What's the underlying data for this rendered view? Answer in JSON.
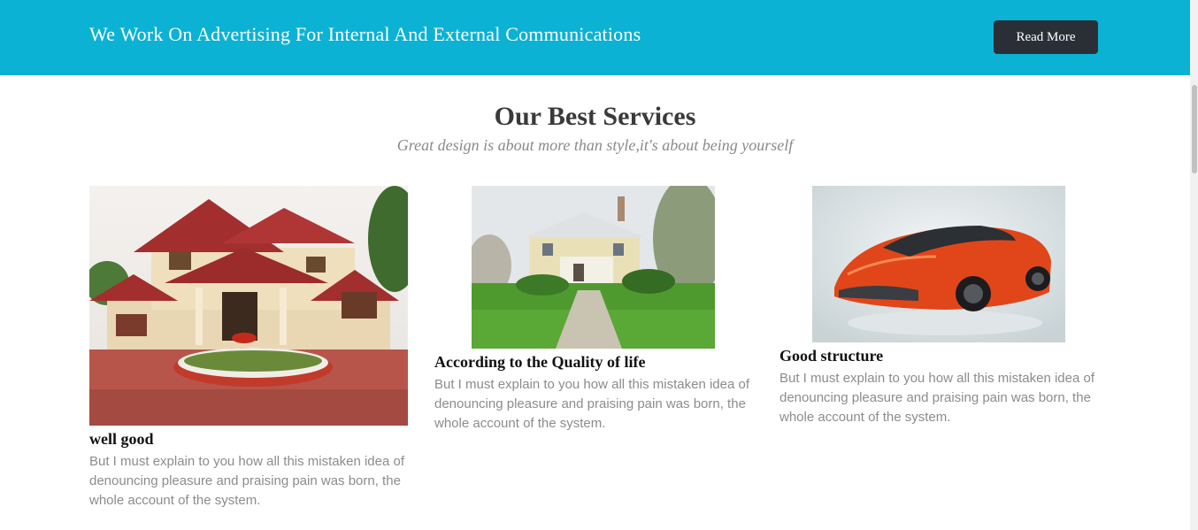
{
  "banner": {
    "text": "We Work On Advertising For Internal And External Communications",
    "button_label": "Read More"
  },
  "services": {
    "title": "Our Best Services",
    "subtitle": "Great design is about more than style,it's about being yourself",
    "cards": [
      {
        "title": "well good",
        "body": "But I must explain to you how all this mistaken idea of denouncing pleasure and praising pain was born, the whole account of the system.",
        "image": "house-photo"
      },
      {
        "title": "According to the Quality of life",
        "body": "But I must explain to you how all this mistaken idea of denouncing pleasure and praising pain was born, the whole account of the system.",
        "image": "villa-photo"
      },
      {
        "title": "Good structure",
        "body": "But I must explain to you how all this mistaken idea of denouncing pleasure and praising pain was born, the whole account of the system.",
        "image": "car-photo"
      }
    ]
  },
  "colors": {
    "banner": "#0bb2d4",
    "button": "#2a2f37",
    "body_text": "#8c8c8c"
  }
}
